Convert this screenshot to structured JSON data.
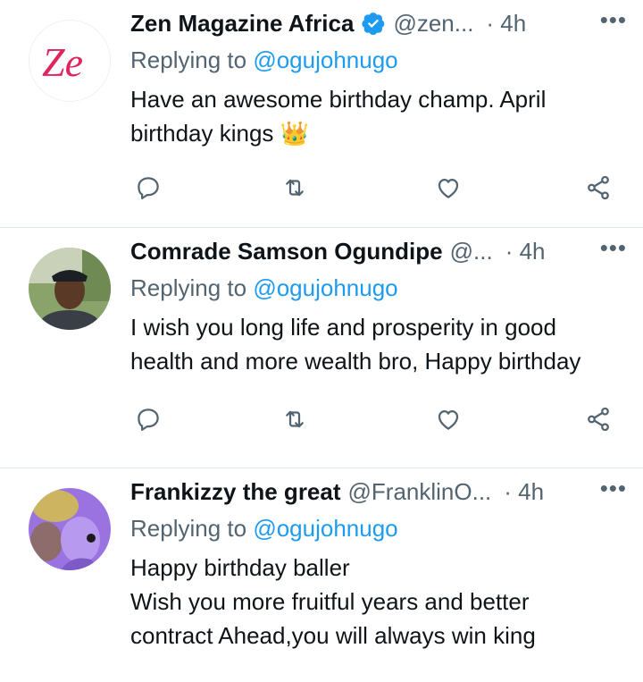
{
  "tweets": [
    {
      "name": "Zen Magazine Africa",
      "verified": true,
      "handle": "@zen...",
      "time": "· 4h",
      "replying_prefix": "Replying to ",
      "replying_to": "@ogujohnugo",
      "text_lines": [
        "Have an awesome birthday champ. April",
        "birthday kings 👑"
      ],
      "avatar_text": "Ze"
    },
    {
      "name": "Comrade Samson Ogundipe",
      "verified": false,
      "handle": "@...",
      "time": "· 4h",
      "replying_prefix": "Replying to ",
      "replying_to": "@ogujohnugo",
      "text_lines": [
        "I wish you long life and prosperity in good",
        "health and more wealth bro, Happy birthday"
      ]
    },
    {
      "name": "Frankizzy the great",
      "verified": false,
      "handle": "@FranklinO...",
      "time": "· 4h",
      "replying_prefix": "Replying to ",
      "replying_to": "@ogujohnugo",
      "text_lines": [
        "Happy birthday baller",
        "Wish you more fruitful years and better",
        "contract Ahead,you will always win king"
      ]
    }
  ],
  "more_glyph": "•••",
  "icons": [
    "reply-icon",
    "retweet-icon",
    "like-icon",
    "share-icon",
    "verified-badge-icon"
  ],
  "colors": {
    "accent": "#1d9bf0",
    "secondary_text": "#536471",
    "divider": "#e1e8ed",
    "zen_logo": "#e0245e"
  }
}
